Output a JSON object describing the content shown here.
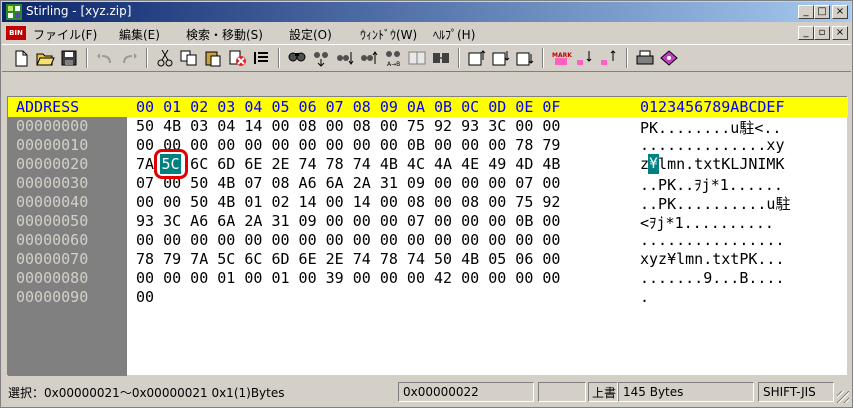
{
  "window": {
    "title": "Stirling - [xyz.zip]",
    "caption_buttons": [
      "_",
      "□",
      "×"
    ],
    "doc_buttons": [
      "_",
      "▫",
      "×"
    ]
  },
  "menu": {
    "doc_icon_label": "BIN",
    "items": [
      {
        "label": "ファイル(F)"
      },
      {
        "label": "編集(E)"
      },
      {
        "label": "検索・移動(S)"
      },
      {
        "label": "設定(O)"
      },
      {
        "label": "ｳｨﾝﾄﾞｳ(W)"
      },
      {
        "label": "ﾍﾙﾌﾟ(H)"
      }
    ]
  },
  "toolbar": {
    "buttons": [
      "new-icon",
      "open-icon",
      "save-icon",
      "undo-icon",
      "redo-icon",
      "cut-icon",
      "copy-icon",
      "paste-icon",
      "delete-icon",
      "list-icon",
      "find-icon",
      "find-next-icon",
      "find-down-icon",
      "find-up-icon",
      "find-replace-icon",
      "compare-icon",
      "jump-icon",
      "bookmark-set-icon",
      "bookmark-next-icon",
      "bookmark-prev-icon",
      "mark-icon",
      "mark-down-icon",
      "mark-up-icon",
      "print-icon",
      "properties-icon"
    ]
  },
  "editor": {
    "header": {
      "address_label": "ADDRESS",
      "hex_columns": "00 01 02 03 04 05 06 07 08 09 0A 0B 0C 0D 0E 0F",
      "ascii_columns": "0123456789ABCDEF"
    },
    "rows": [
      {
        "address": "00000000",
        "hex": "50 4B 03 04 14 00 08 00 08 00 75 92 93 3C 00 00",
        "ascii": "PK........u駐<.."
      },
      {
        "address": "00000010",
        "hex": "00 00 00 00 00 00 00 00 00 00 0B 00 00 00 78 79",
        "ascii": "..............xy"
      },
      {
        "address": "00000020",
        "hex": "7A    6C 6D 6E 2E 74 78 74 4B 4C 4A 4E 49 4D 4B",
        "ascii": "z lmn.txtKLJNIMK"
      },
      {
        "address": "00000030",
        "hex": "07 00 50 4B 07 08 A6 6A 2A 31 09 00 00 00 07 00",
        "ascii": "..PK..ｦj*1......"
      },
      {
        "address": "00000040",
        "hex": "00 00 50 4B 01 02 14 00 14 00 08 00 08 00 75 92",
        "ascii": "..PK..........u駐"
      },
      {
        "address": "00000050",
        "hex": "93 3C A6 6A 2A 31 09 00 00 00 07 00 00 00 0B 00",
        "ascii": "<ｦj*1.........."
      },
      {
        "address": "00000060",
        "hex": "00 00 00 00 00 00 00 00 00 00 00 00 00 00 00 00",
        "ascii": "................"
      },
      {
        "address": "00000070",
        "hex": "78 79 7A 5C 6C 6D 6E 2E 74 78 74 50 4B 05 06 00",
        "ascii": "xyz¥lmn.txtPK..."
      },
      {
        "address": "00000080",
        "hex": "00 00 00 01 00 01 00 39 00 00 00 42 00 00 00 00",
        "ascii": ".......9...B...."
      },
      {
        "address": "00000090",
        "hex": "00",
        "ascii": "."
      }
    ],
    "selected_byte": {
      "hex": "5C",
      "ascii": "¥"
    }
  },
  "status": {
    "selection": "選択：0x00000021～0x00000021  0x1(1)Bytes",
    "cursor": "0x00000022",
    "mode": "上書",
    "size": "145 Bytes",
    "encoding": "SHIFT-JIS"
  },
  "colors": {
    "header_bg": "#ffff00",
    "header_text": "#0000ff",
    "address_bg": "#808080",
    "selection_bg": "#008080",
    "highlight_circle": "#e00000"
  }
}
